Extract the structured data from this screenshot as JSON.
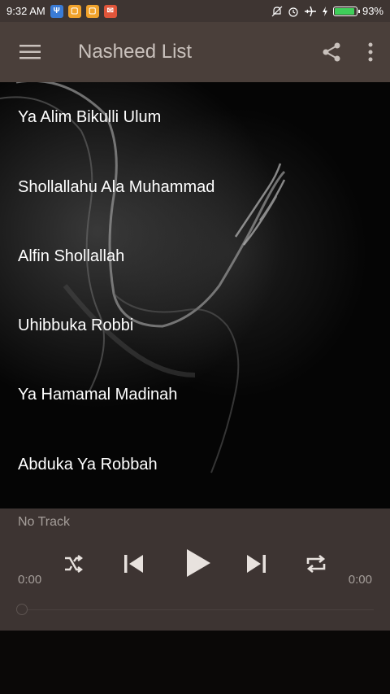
{
  "status_bar": {
    "time": "9:32 AM",
    "battery_text": "93%",
    "battery_level": 0.93,
    "icons": [
      "usb-icon",
      "app-icon-1",
      "app-icon-2",
      "mail-icon",
      "mute-icon",
      "alarm-icon",
      "airplane-icon",
      "charging-icon"
    ]
  },
  "appbar": {
    "title": "Nasheed List"
  },
  "list": {
    "items": [
      {
        "label": "Ya Alim Bikulli Ulum"
      },
      {
        "label": "Shollallahu Ala Muhammad"
      },
      {
        "label": "Alfin Shollallah"
      },
      {
        "label": "Uhibbuka Robbi"
      },
      {
        "label": "Ya Hamamal Madinah"
      },
      {
        "label": "Abduka Ya Robbah"
      }
    ]
  },
  "player": {
    "track": "No Track",
    "elapsed": "0:00",
    "duration": "0:00",
    "progress": 0
  },
  "colors": {
    "appbar": "#4a3f3a",
    "statusbar": "#3e3532",
    "player": "#3d3432",
    "battery": "#3fcf5a"
  }
}
